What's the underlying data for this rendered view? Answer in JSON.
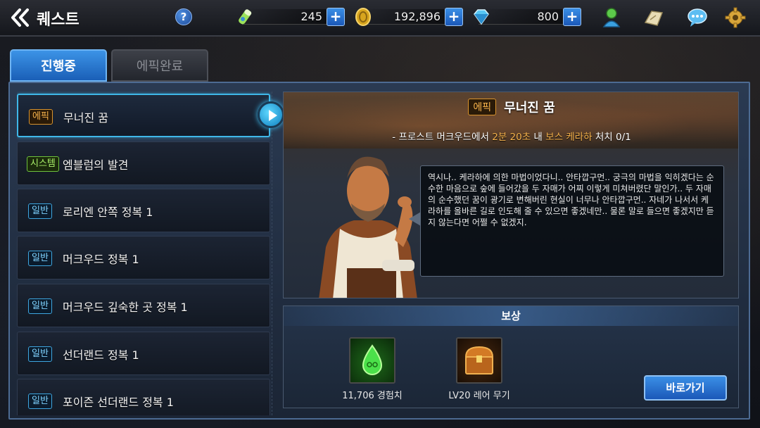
{
  "header": {
    "title": "퀘스트",
    "help_label": "?",
    "currencies": [
      {
        "name": "stamina",
        "icon": "stamina-potion-icon",
        "value": "245"
      },
      {
        "name": "gold",
        "icon": "gold-coin-icon",
        "value": "192,896"
      },
      {
        "name": "gems",
        "icon": "gem-icon",
        "value": "800"
      }
    ],
    "plus_label": "+",
    "right_icons": [
      "character-icon",
      "map-icon",
      "chat-icon",
      "settings-gear-icon"
    ]
  },
  "tabs": [
    {
      "label": "진행중",
      "active": true
    },
    {
      "label": "에픽완료",
      "active": false
    }
  ],
  "quests": [
    {
      "badge": "에픽",
      "type": "epic",
      "name": "무너진 꿈",
      "selected": true
    },
    {
      "badge": "시스템",
      "type": "system",
      "name": "엠블럼의 발견",
      "selected": false
    },
    {
      "badge": "일반",
      "type": "normal",
      "name": "로리엔 안쪽 정복 1",
      "selected": false
    },
    {
      "badge": "일반",
      "type": "normal",
      "name": "머크우드 정복 1",
      "selected": false
    },
    {
      "badge": "일반",
      "type": "normal",
      "name": "머크우드 깊숙한 곳 정복 1",
      "selected": false
    },
    {
      "badge": "일반",
      "type": "normal",
      "name": "선더랜드 정복 1",
      "selected": false
    },
    {
      "badge": "일반",
      "type": "normal",
      "name": "포이즌 선더랜드 정복 1",
      "selected": false
    }
  ],
  "detail": {
    "badge": "에픽",
    "title": "무너진 꿈",
    "objective_prefix": "- 프로스트 머크우드에서 ",
    "objective_time": "2분 20초",
    "objective_mid": " 내 ",
    "objective_target": "보스 케라하",
    "objective_suffix": " 처치 0/1",
    "dialogue": "역시나.. 케라하에 의한 마법이었다니.. 안타깝구먼.. 궁극의 마법을 익히겠다는 순수한 마음으로 숲에 들어갔을 두 자매가 어찌 이렇게 미쳐버렸단 말인가.. 두 자매의 순수했던 꿈이 광기로 변해버린 현실이 너무나 안타깝구먼.. 자네가 나서서 케라하를 올바른 길로 인도해 줄 수 있으면 좋겠네만.. 물론 말로 들으면 좋겠지만 듣지 않는다면 어쩔 수 없겠지."
  },
  "reward": {
    "title": "보상",
    "items": [
      {
        "label": "11,706 경험치",
        "icon": "experience-drop-icon"
      },
      {
        "label": "LV20 레어 무기",
        "icon": "treasure-chest-icon"
      }
    ],
    "goto_label": "바로가기"
  }
}
